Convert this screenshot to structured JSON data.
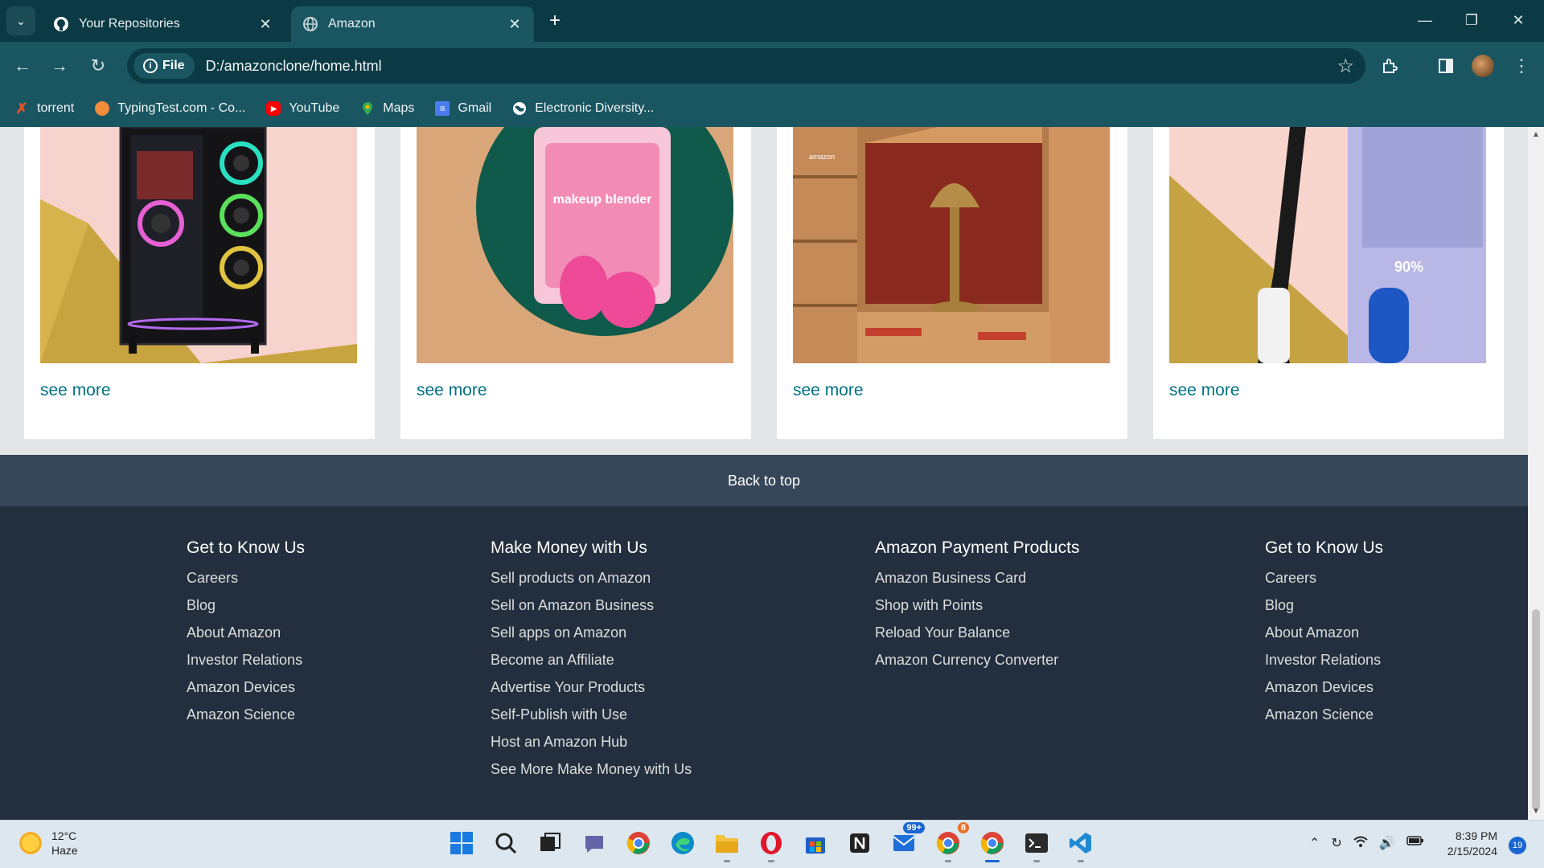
{
  "browser": {
    "tabs": [
      {
        "title": "Your Repositories",
        "icon": "github-icon",
        "active": false
      },
      {
        "title": "Amazon",
        "icon": "globe-icon",
        "active": true
      }
    ],
    "new_tab": "+",
    "address": {
      "chip": "File",
      "url": "D:/amazonclone/home.html"
    },
    "bookmarks": [
      {
        "label": "torrent",
        "icon": "x-icon",
        "color": "#e8542a"
      },
      {
        "label": "TypingTest.com - Co...",
        "icon": "typingtest-icon",
        "color": "#f08c3a"
      },
      {
        "label": "YouTube",
        "icon": "youtube-icon",
        "color": "#ff0000"
      },
      {
        "label": "Maps",
        "icon": "maps-icon",
        "color": "#34a853"
      },
      {
        "label": "Gmail",
        "icon": "gmail-icon",
        "color": "#4a7cf0"
      },
      {
        "label": "Electronic Diversity...",
        "icon": "globe-icon",
        "color": "#ffffff"
      }
    ]
  },
  "page": {
    "cards": [
      {
        "link": "see more",
        "image": "gaming-pc-image"
      },
      {
        "link": "see more",
        "image": "makeup-blender-image"
      },
      {
        "link": "see more",
        "image": "amazon-boxes-lamp-image"
      },
      {
        "link": "see more",
        "image": "toothbrush-image"
      }
    ],
    "makeup_text": "makeup blender",
    "box_text": "amazon",
    "toothbrush_text": "90%",
    "back_to_top": "Back to top",
    "footer": {
      "columns": [
        {
          "title": "Get to Know Us",
          "links": [
            "Careers",
            "Blog",
            "About Amazon",
            "Investor Relations",
            "Amazon Devices",
            "Amazon Science"
          ]
        },
        {
          "title": "Make Money with Us",
          "links": [
            "Sell products on Amazon",
            "Sell on Amazon Business",
            "Sell apps on Amazon",
            "Become an Affiliate",
            "Advertise Your Products",
            "Self-Publish with Use",
            "Host an Amazon Hub",
            "See More Make Money with Us"
          ]
        },
        {
          "title": "Amazon Payment Products",
          "links": [
            "Amazon Business Card",
            "Shop with Points",
            "Reload Your Balance",
            "Amazon Currency Converter"
          ]
        },
        {
          "title": "Get to Know Us",
          "links": [
            "Careers",
            "Blog",
            "About Amazon",
            "Investor Relations",
            "Amazon Devices",
            "Amazon Science"
          ]
        }
      ]
    }
  },
  "taskbar": {
    "weather": {
      "temp": "12°C",
      "condition": "Haze"
    },
    "mail_badge": "99+",
    "chrome_badge": "8",
    "time": "8:39 PM",
    "date": "2/15/2024",
    "notifications": "19"
  }
}
